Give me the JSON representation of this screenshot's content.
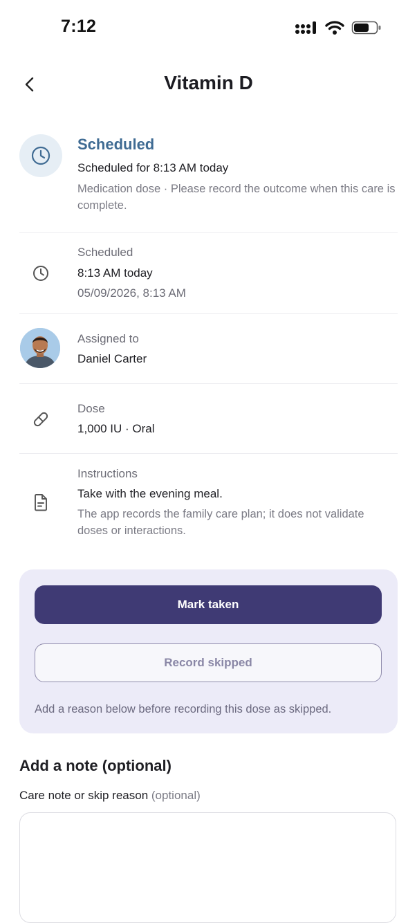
{
  "status_bar": {
    "time": "7:12"
  },
  "header": {
    "title": "Vitamin D"
  },
  "status": {
    "title": "Scheduled",
    "subtitle": "Scheduled for 8:13 AM today",
    "description": "Medication dose · Please record the outcome when this care is complete."
  },
  "schedule": {
    "label": "Scheduled",
    "value": "8:13 AM today",
    "detail": "05/09/2026, 8:13 AM"
  },
  "assigned": {
    "label": "Assigned to",
    "value": "Daniel Carter"
  },
  "dose": {
    "label": "Dose",
    "value": "1,000 IU · Oral"
  },
  "instructions": {
    "label": "Instructions",
    "value": "Take with the evening meal.",
    "note": "The app records the family care plan; it does not validate doses or interactions."
  },
  "actions": {
    "mark_taken": "Mark taken",
    "record_skipped": "Record skipped",
    "hint": "Add a reason below before recording this dose as skipped."
  },
  "note_section": {
    "title": "Add a note (optional)",
    "field_label": "Care note or skip reason",
    "field_optional": "(optional)",
    "value": ""
  },
  "colors": {
    "accent": "#3f3a74",
    "status": "#3f6b93",
    "card_bg": "#ecebf8"
  },
  "icons": [
    "back-chevron-icon",
    "clock-icon",
    "pill-icon",
    "document-icon",
    "signal-icon",
    "wifi-icon",
    "battery-icon"
  ]
}
